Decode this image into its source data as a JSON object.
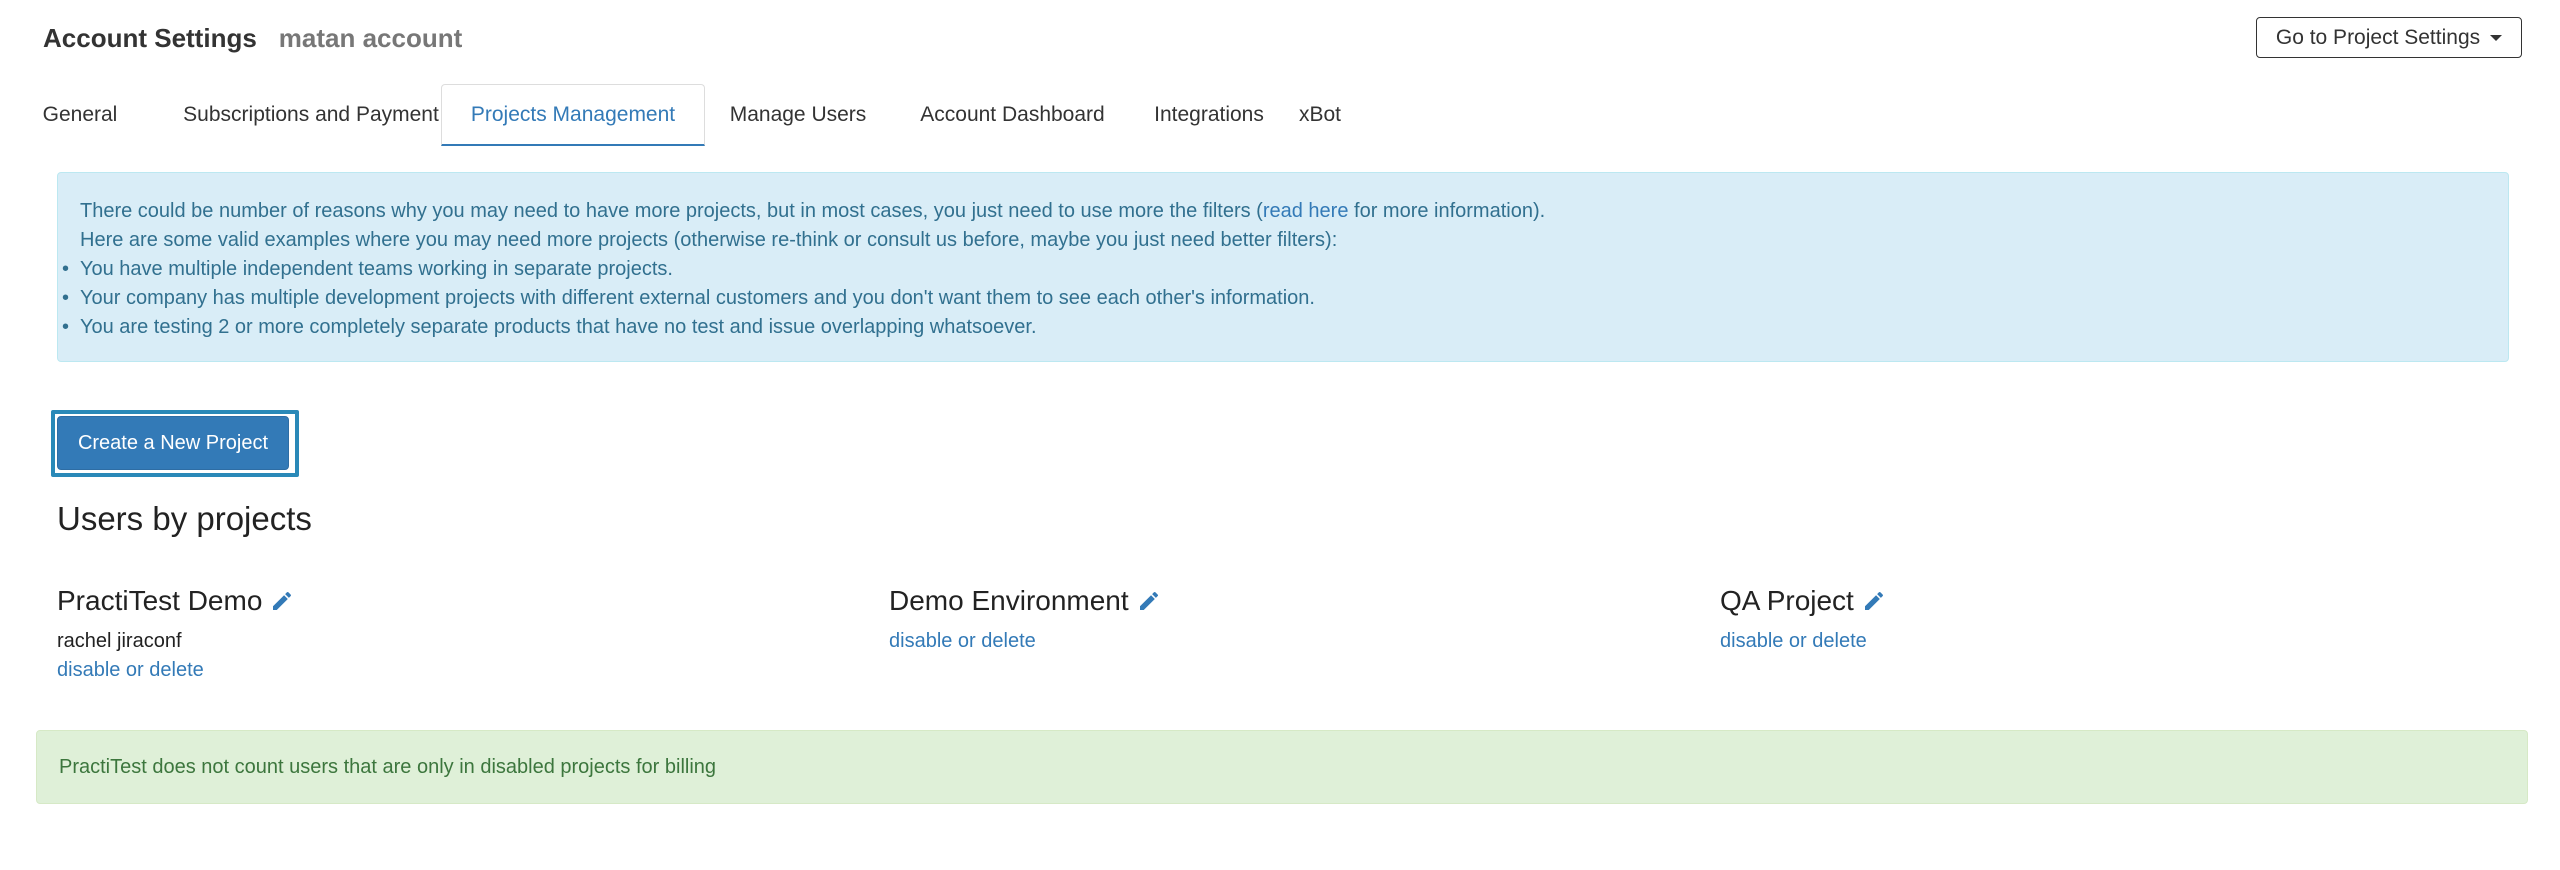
{
  "header": {
    "title": "Account Settings",
    "account_name": "matan account",
    "project_settings_button": "Go to Project Settings"
  },
  "tabs": [
    {
      "label": "General",
      "active": false
    },
    {
      "label": "Subscriptions and Payment",
      "active": false
    },
    {
      "label": "Projects Management",
      "active": true
    },
    {
      "label": "Manage Users",
      "active": false
    },
    {
      "label": "Account Dashboard",
      "active": false
    },
    {
      "label": "Integrations",
      "active": false
    },
    {
      "label": "xBot",
      "active": false
    }
  ],
  "info": {
    "line1_before": "There could be number of reasons why you may need to have more projects, but in most cases, you just need to use more the filters (",
    "line1_link": "read here",
    "line1_after": " for more information).",
    "line2": "Here are some valid examples where you may need more projects (otherwise re-think or consult us before, maybe you just need better filters):",
    "bullets": [
      "You have multiple independent teams working in separate projects.",
      "Your company has multiple development projects with different external customers and you don't want them to see each other's information.",
      "You are testing 2 or more completely separate products that have no test and issue overlapping whatsoever."
    ]
  },
  "create_button": "Create a New Project",
  "section_title": "Users by projects",
  "projects": [
    {
      "name": "PractiTest Demo",
      "users": [
        "rachel jiraconf"
      ],
      "action": "disable or delete"
    },
    {
      "name": "Demo Environment",
      "users": [],
      "action": "disable or delete"
    },
    {
      "name": "QA Project",
      "users": [],
      "action": "disable or delete"
    }
  ],
  "billing_note": "PractiTest does not count users that are only in disabled projects for billing",
  "colors": {
    "link": "#337ab7",
    "info_bg": "#d9edf7",
    "success_bg": "#dff0d8",
    "button_primary": "#337ab7"
  }
}
